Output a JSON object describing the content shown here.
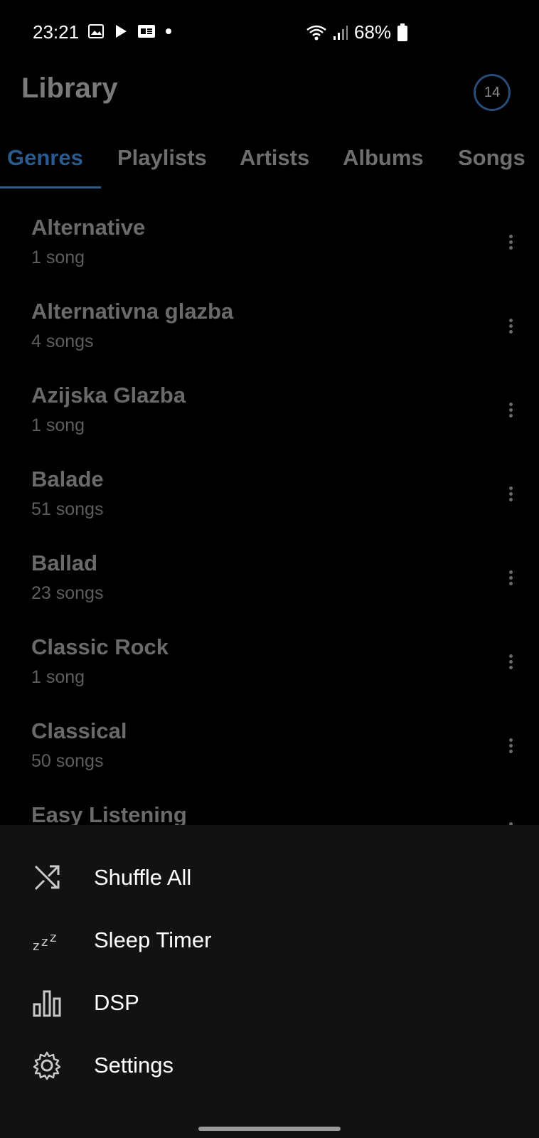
{
  "status_bar": {
    "time": "23:21",
    "battery": "68%",
    "icons": [
      "gallery-icon",
      "play-icon",
      "ge-icon",
      "dot-icon",
      "wifi-icon",
      "signal-icon",
      "battery-icon"
    ]
  },
  "header": {
    "title": "Library",
    "badge": "14"
  },
  "tabs": [
    {
      "label": "Genres",
      "active": true
    },
    {
      "label": "Playlists",
      "active": false
    },
    {
      "label": "Artists",
      "active": false
    },
    {
      "label": "Albums",
      "active": false
    },
    {
      "label": "Songs",
      "active": false
    }
  ],
  "genres": [
    {
      "name": "Alternative",
      "count": "1 song"
    },
    {
      "name": "Alternativna glazba",
      "count": "4 songs"
    },
    {
      "name": "Azijska Glazba",
      "count": "1 song"
    },
    {
      "name": "Balade",
      "count": "51 songs"
    },
    {
      "name": "Ballad",
      "count": "23 songs"
    },
    {
      "name": "Classic Rock",
      "count": "1 song"
    },
    {
      "name": "Classical",
      "count": "50 songs"
    },
    {
      "name": "Easy Listening",
      "count": ""
    }
  ],
  "sheet": {
    "items": [
      {
        "label": "Shuffle All",
        "icon": "shuffle-icon"
      },
      {
        "label": "Sleep Timer",
        "icon": "sleep-icon"
      },
      {
        "label": "DSP",
        "icon": "equalizer-icon"
      },
      {
        "label": "Settings",
        "icon": "gear-icon"
      }
    ]
  },
  "colors": {
    "accent": "#2b5a8f",
    "background": "#000000",
    "sheet": "#121212"
  }
}
